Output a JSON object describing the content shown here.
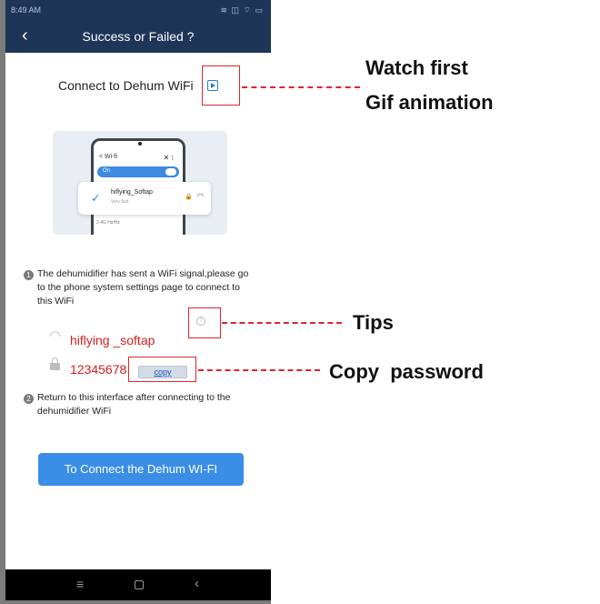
{
  "status_bar": {
    "time": "8:49 AM",
    "icons": "≋ ◫ ⌔ ▭"
  },
  "app_bar": {
    "title": "Success or Failed ?",
    "back_icon": "chevron-left-icon"
  },
  "connect_title": "Connect to Dehum WiFi",
  "gif_button_icon": "play-icon",
  "wifi_illustration": {
    "back_text": "< Wi-fi",
    "toggle_label": "On",
    "network_name": "hiflying_Softap",
    "network_sub": "Very fast",
    "other_network": "2.4G Hz/Hz"
  },
  "steps": [
    {
      "number": "1",
      "text": "The dehumidifier has sent a WiFi signal,please go to the phone system settings page to connect to this WiFi"
    },
    {
      "number": "2",
      "text": "Return to this interface after connecting to the dehumidifier WiFi"
    }
  ],
  "wifi_name": "hiflying _softap",
  "password": "12345678",
  "copy_label": "copy",
  "connect_button": "To Connect the Dehum WI-FI",
  "nav": {
    "menu": "≡",
    "back": "‹"
  },
  "annotations": {
    "gif": [
      "Watch first",
      "Gif animation"
    ],
    "tips": "Tips",
    "copy": "Copy  password"
  },
  "colors": {
    "header": "#1d3557",
    "accent": "#3a8ee6",
    "highlight": "#d51e1e",
    "callout": "#e0242b"
  }
}
